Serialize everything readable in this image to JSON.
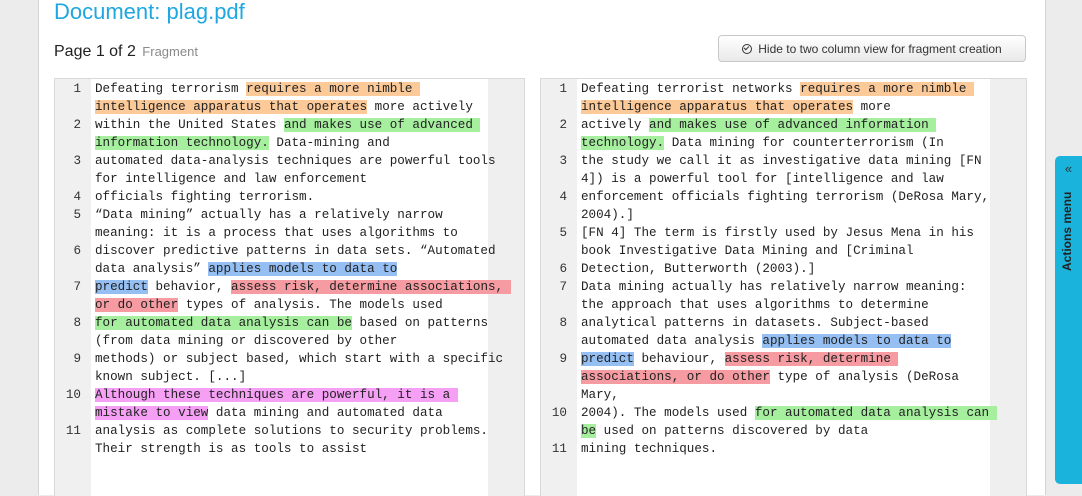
{
  "document": {
    "title": "Document: plag.pdf",
    "page_label": "Page 1 of 2",
    "fragment_label": "Fragment"
  },
  "toolbar": {
    "hide_button_label": "Hide to two column view for fragment creation",
    "hide_button_icon": "check-circle-icon"
  },
  "actions_menu": {
    "label": "Actions menu",
    "chevron": "«"
  },
  "highlight_colors": {
    "orange": "#fcc998",
    "green": "#a6ef9f",
    "blue": "#95bff2",
    "red": "#f59ba1",
    "magenta": "#f5a0f5"
  },
  "left_pane": [
    {
      "n": "1",
      "segs": [
        {
          "t": "Defeating terrorism "
        },
        {
          "t": "requires a more nimble intelligence apparatus that operates",
          "h": "orange"
        },
        {
          "t": " more actively"
        }
      ]
    },
    {
      "n": "2",
      "segs": [
        {
          "t": "within the United States "
        },
        {
          "t": "and makes use of advanced information technology.",
          "h": "green"
        },
        {
          "t": " Data-mining and"
        }
      ]
    },
    {
      "n": "3",
      "segs": [
        {
          "t": "automated data-analysis techniques are powerful tools for intelligence and law enforcement"
        }
      ]
    },
    {
      "n": "4",
      "segs": [
        {
          "t": "officials fighting terrorism."
        }
      ]
    },
    {
      "n": "5",
      "segs": [
        {
          "t": "“Data mining” actually has a relatively narrow meaning: it is a process that uses algorithms to"
        }
      ]
    },
    {
      "n": "6",
      "segs": [
        {
          "t": "discover predictive patterns in data sets. “Automated data analysis” "
        },
        {
          "t": "applies models to data to",
          "h": "blue"
        }
      ]
    },
    {
      "n": "7",
      "segs": [
        {
          "t": "predict",
          "h": "blue"
        },
        {
          "t": " behavior, "
        },
        {
          "t": "assess risk, determine associations, or do other",
          "h": "red"
        },
        {
          "t": " types of analysis. The models used"
        }
      ]
    },
    {
      "n": "8",
      "segs": [
        {
          "t": "for automated data analysis can be",
          "h": "green"
        },
        {
          "t": " based on patterns (from data mining or discovered by other"
        }
      ]
    },
    {
      "n": "9",
      "segs": [
        {
          "t": "methods) or subject based, which start with a specific known subject. [...]"
        }
      ]
    },
    {
      "n": "10",
      "segs": [
        {
          "t": "Although these techniques are powerful, it is a mistake to view",
          "h": "magenta"
        },
        {
          "t": " data mining and automated data"
        }
      ]
    },
    {
      "n": "11",
      "segs": [
        {
          "t": "analysis as complete solutions to security problems. Their strength is as tools to assist"
        }
      ]
    }
  ],
  "right_pane": [
    {
      "n": "1",
      "segs": [
        {
          "t": "Defeating terrorist networks "
        },
        {
          "t": "requires a more nimble intelligence apparatus that operates",
          "h": "orange"
        },
        {
          "t": " more"
        }
      ]
    },
    {
      "n": "2",
      "segs": [
        {
          "t": "actively "
        },
        {
          "t": "and makes use of advanced information technology.",
          "h": "green"
        },
        {
          "t": " Data mining for counterterrorism (In"
        }
      ]
    },
    {
      "n": "3",
      "segs": [
        {
          "t": "the study we call it as investigative data mining [FN 4]) is a powerful tool for [intelligence and law"
        }
      ]
    },
    {
      "n": "4",
      "segs": [
        {
          "t": "enforcement officials fighting terrorism (DeRosa Mary, 2004).]"
        }
      ]
    },
    {
      "n": "5",
      "segs": [
        {
          "t": "[FN 4] The term is firstly used by Jesus Mena in his book Investigative Data Mining and [Criminal"
        }
      ]
    },
    {
      "n": "6",
      "segs": [
        {
          "t": "Detection, Butterworth (2003).]"
        }
      ]
    },
    {
      "n": "7",
      "segs": [
        {
          "t": "Data mining actually has relatively narrow meaning: the approach that uses algorithms to determine"
        }
      ]
    },
    {
      "n": "8",
      "segs": [
        {
          "t": "analytical patterns in datasets. Subject-based automated data analysis "
        },
        {
          "t": "applies models to data to",
          "h": "blue"
        }
      ]
    },
    {
      "n": "9",
      "segs": [
        {
          "t": "predict",
          "h": "blue"
        },
        {
          "t": " behaviour, "
        },
        {
          "t": "assess risk, determine associations, or do other",
          "h": "red"
        },
        {
          "t": " type of analysis (DeRosa Mary,"
        }
      ]
    },
    {
      "n": "10",
      "segs": [
        {
          "t": "2004). The models used "
        },
        {
          "t": "for automated data analysis can be",
          "h": "green"
        },
        {
          "t": " used on patterns discovered by data"
        }
      ]
    },
    {
      "n": "11",
      "segs": [
        {
          "t": "mining techniques."
        }
      ]
    }
  ]
}
